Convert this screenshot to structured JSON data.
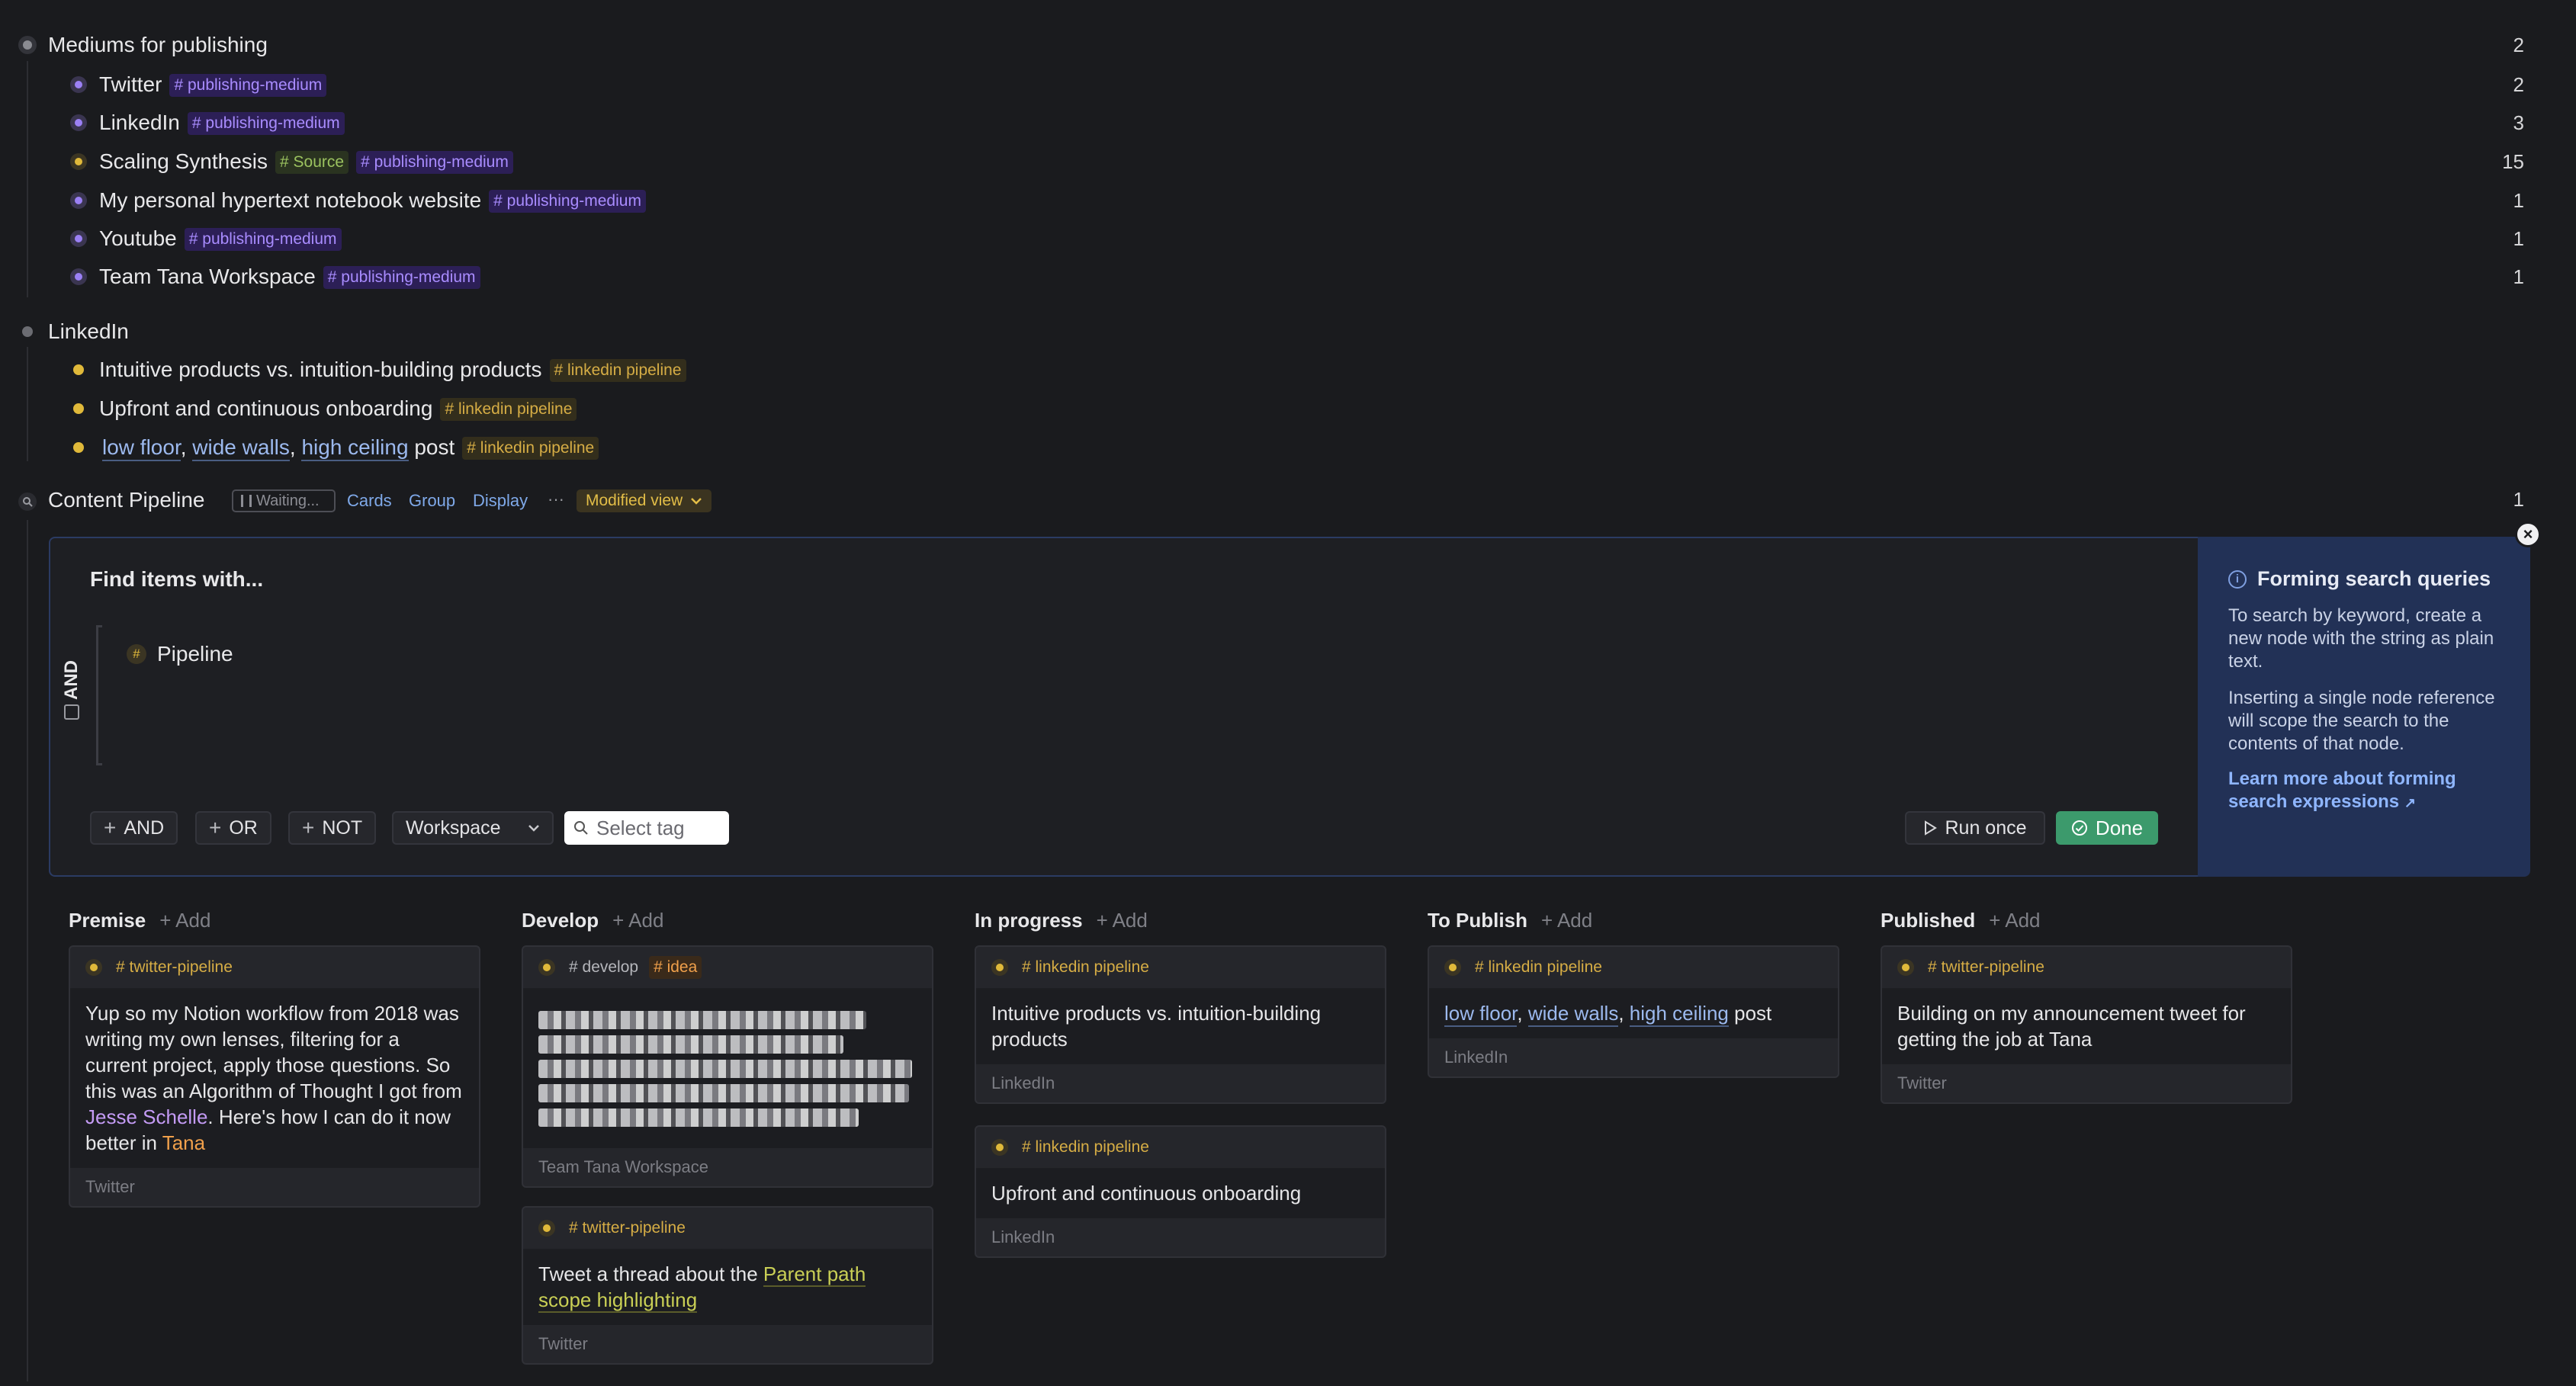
{
  "mediums": {
    "title": "Mediums for publishing",
    "count": "2",
    "items": [
      {
        "label": "Twitter",
        "tags": [
          "# publishing-medium"
        ],
        "count": "2"
      },
      {
        "label": "LinkedIn",
        "tags": [
          "# publishing-medium"
        ],
        "count": "3"
      },
      {
        "label": "Scaling Synthesis",
        "source_tag": "# Source",
        "tags": [
          "# publishing-medium"
        ],
        "count": "15"
      },
      {
        "label": "My personal hypertext notebook website",
        "tags": [
          "# publishing-medium"
        ],
        "count": "1"
      },
      {
        "label": "Youtube",
        "tags": [
          "# publishing-medium"
        ],
        "count": "1"
      },
      {
        "label": "Team Tana Workspace",
        "tags": [
          "# publishing-medium"
        ],
        "count": "1"
      }
    ]
  },
  "linkedin": {
    "title": "LinkedIn",
    "items": [
      {
        "label": "Intuitive products vs. intuition-building products",
        "tag": "# linkedin pipeline"
      },
      {
        "label": "Upfront and continuous onboarding",
        "tag": "# linkedin pipeline"
      },
      {
        "ref1": "low floor",
        "ref2": "wide walls",
        "ref3": "high ceiling",
        "suffix": "post",
        "tag": "# linkedin pipeline"
      }
    ]
  },
  "pipeline": {
    "title": "Content Pipeline",
    "waiting": "Waiting...",
    "cards_label": "Cards",
    "group_label": "Group",
    "display_label": "Display",
    "more_label": "···",
    "modified_label": "Modified view",
    "count": "1"
  },
  "query": {
    "heading": "Find items with...",
    "operator": "AND",
    "term_hash": "#",
    "term": "Pipeline",
    "and_btn": "AND",
    "or_btn": "OR",
    "not_btn": "NOT",
    "scope": "Workspace",
    "select_tag_placeholder": "Select tag",
    "run_once": "Run once",
    "done": "Done"
  },
  "help": {
    "title": "Forming search queries",
    "p1": "To search by keyword, create a new node with the string as plain text.",
    "p2": "Inserting a single node reference will scope the search to the contents of that node.",
    "link": "Learn more about forming search expressions"
  },
  "board": {
    "add_label": "Add",
    "columns": [
      {
        "title": "Premise"
      },
      {
        "title": "Develop"
      },
      {
        "title": "In progress"
      },
      {
        "title": "To Publish"
      },
      {
        "title": "Published"
      }
    ],
    "cards": {
      "premise_1": {
        "tag": "# twitter-pipeline",
        "text_a": "Yup so my Notion workflow from 2018 was writing my own lenses, filtering for a current project, apply those questions. So this was an Algorithm of Thought I got from ",
        "ref_person": "Jesse Schelle",
        "text_b": ". Here's how I can do it now better in ",
        "ref_tana": "Tana",
        "foot": "Twitter"
      },
      "develop_1": {
        "tag1": "# develop",
        "tag2": "# idea",
        "foot": "Team Tana Workspace"
      },
      "develop_2": {
        "tag": "# twitter-pipeline",
        "text": "Tweet a thread about the ",
        "ref": "Parent path scope highlighting",
        "foot": "Twitter"
      },
      "progress_1": {
        "tag": "# linkedin pipeline",
        "text": "Intuitive products vs. intuition-building products",
        "foot": "LinkedIn"
      },
      "progress_2": {
        "tag": "# linkedin pipeline",
        "text": "Upfront and continuous onboarding",
        "foot": "LinkedIn"
      },
      "publish_1": {
        "tag": "# linkedin pipeline",
        "ref1": "low floor",
        "ref2": "wide walls",
        "ref3": "high ceiling",
        "suffix": "post",
        "foot": "LinkedIn"
      },
      "published_1": {
        "tag": "# twitter-pipeline",
        "text": "Building on my announcement tweet for getting the job at Tana",
        "foot": "Twitter"
      }
    }
  },
  "colors": {
    "background": "#1a1b1e",
    "purple_tag": "#a98cff",
    "gold_tag": "#d6ad45",
    "green_tag": "#9bc25f",
    "done_button": "#3c9a6c",
    "help_panel": "#223156"
  }
}
